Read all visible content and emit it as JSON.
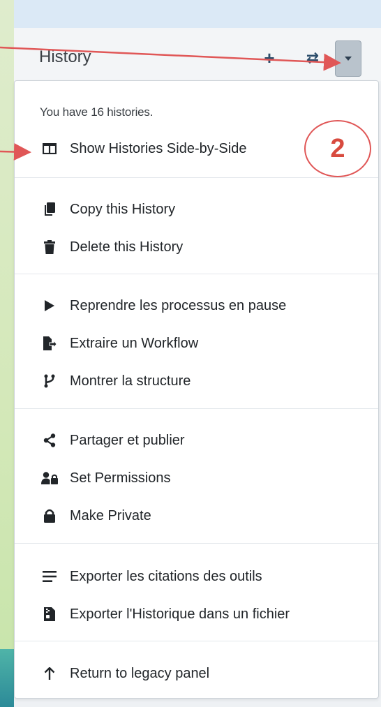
{
  "header": {
    "title": "History",
    "plus_icon": "+",
    "switch_icon": "⇄"
  },
  "menu": {
    "info": "You have 16 histories.",
    "items": [
      {
        "label": "Show Histories Side-by-Side",
        "icon": "columns-icon"
      },
      {
        "label": "Copy this History",
        "icon": "copy-icon"
      },
      {
        "label": "Delete this History",
        "icon": "trash-icon"
      },
      {
        "label": "Reprendre les processus en pause",
        "icon": "play-icon"
      },
      {
        "label": "Extraire un Workflow",
        "icon": "file-export-icon"
      },
      {
        "label": "Montrer la structure",
        "icon": "code-branch-icon"
      },
      {
        "label": "Partager et publier",
        "icon": "share-icon"
      },
      {
        "label": "Set Permissions",
        "icon": "user-lock-icon"
      },
      {
        "label": "Make Private",
        "icon": "lock-icon"
      },
      {
        "label": "Exporter les citations des outils",
        "icon": "list-icon"
      },
      {
        "label": "Exporter l'Historique dans un fichier",
        "icon": "file-archive-icon"
      },
      {
        "label": "Return to legacy panel",
        "icon": "arrow-up-icon"
      }
    ]
  },
  "annotation": {
    "number": "2",
    "color": "#e05757"
  }
}
